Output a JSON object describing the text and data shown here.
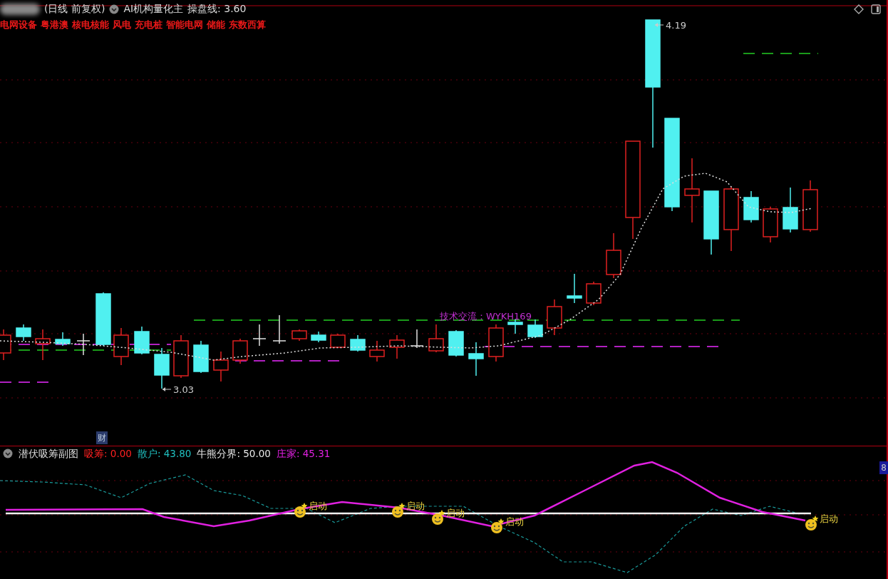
{
  "header": {
    "period": "(日线 前复权)",
    "indicator": "AI机构量化主",
    "line_label": "操盘线:",
    "line_value": "3.60"
  },
  "concepts": [
    "电网设备",
    "粤港澳",
    "核电核能",
    "风电",
    "充电桩",
    "智能电网",
    "储能",
    "东数西算"
  ],
  "price_labels": {
    "high": "4.19",
    "low": "3.03"
  },
  "annotation": "技术交流：WYKH169",
  "finance_badge": "财",
  "sub_panel": {
    "title": "潜伏吸筹副图",
    "axis_value": "8",
    "metrics": [
      {
        "label": "吸筹:",
        "value": "0.00",
        "color": "#ff2020"
      },
      {
        "label": "散户:",
        "value": "43.80",
        "color": "#20c0c0"
      },
      {
        "label": "牛熊分界:",
        "value": "50.00",
        "color": "#e8e8e8"
      },
      {
        "label": "庄家:",
        "value": "45.31",
        "color": "#e020e0"
      }
    ],
    "signals": [
      "启动",
      "启动",
      "启动",
      "启动",
      "启动"
    ]
  }
}
